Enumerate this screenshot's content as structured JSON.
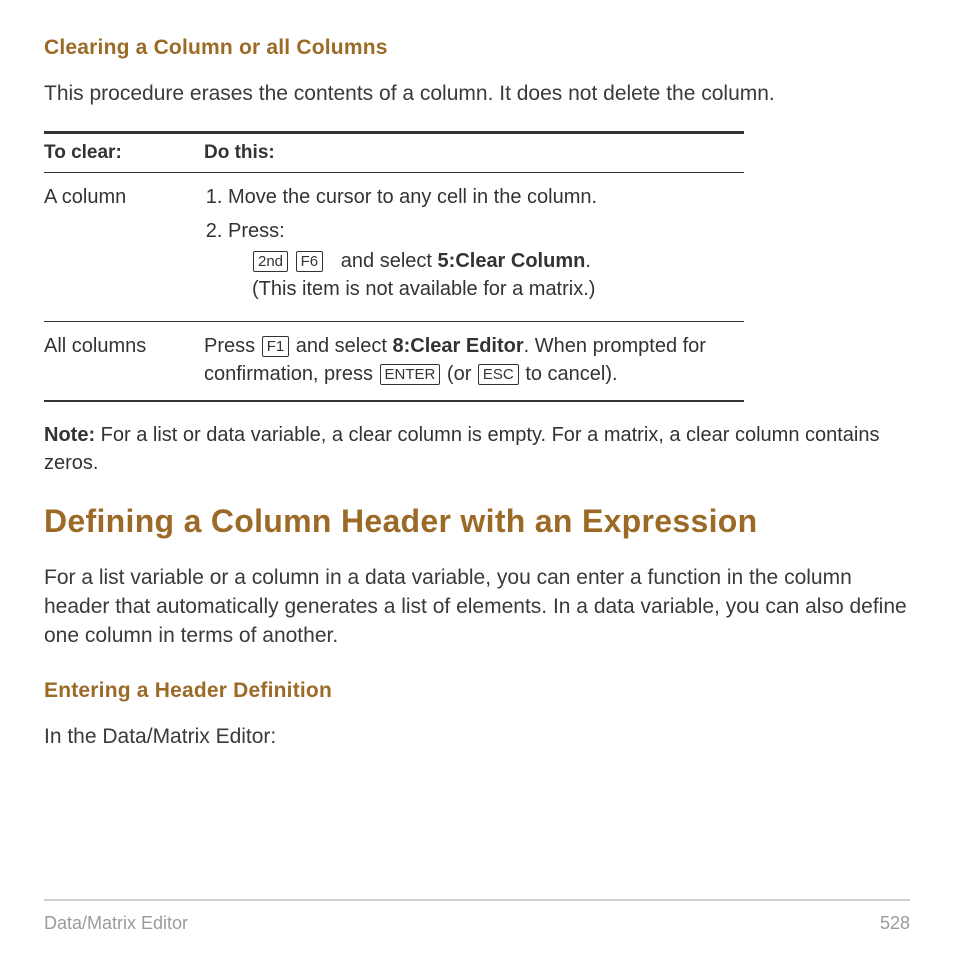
{
  "section1": {
    "heading": "Clearing a Column or all Columns",
    "intro": "This procedure erases the contents of a column. It does not delete the column."
  },
  "table": {
    "headers": {
      "col1": "To clear:",
      "col2": "Do this:"
    },
    "rows": [
      {
        "label": "A column",
        "step1": "Move the cursor to any cell in the column.",
        "step2_prefix": "Press:",
        "step2_keys": {
          "k1": "2nd",
          "k2": "F6"
        },
        "step2_text_a": " and select ",
        "step2_bold": "5:Clear Column",
        "step2_text_b": ".",
        "step2_note": "(This item is not available for a matrix.)"
      },
      {
        "label": "All columns",
        "text_a": "Press ",
        "key1": "F1",
        "text_b": " and select ",
        "bold1": "8:Clear Editor",
        "text_c": ". When prompted for confirmation, press ",
        "key2": "ENTER",
        "text_d": " (or ",
        "key3": "ESC",
        "text_e": " to cancel)."
      }
    ]
  },
  "note": {
    "label": "Note:",
    "text": " For a list or data variable, a clear column is empty. For a matrix, a clear column contains zeros."
  },
  "section2": {
    "heading": "Defining a Column Header with an Expression",
    "intro": "For a list variable or a column in a data variable, you can enter a function in the column header that automatically generates a list of elements. In a data variable, you can also define one column in terms of another."
  },
  "section3": {
    "heading": "Entering a Header Definition",
    "intro": "In the Data/Matrix Editor:"
  },
  "footer": {
    "left": "Data/Matrix Editor",
    "right": "528"
  }
}
